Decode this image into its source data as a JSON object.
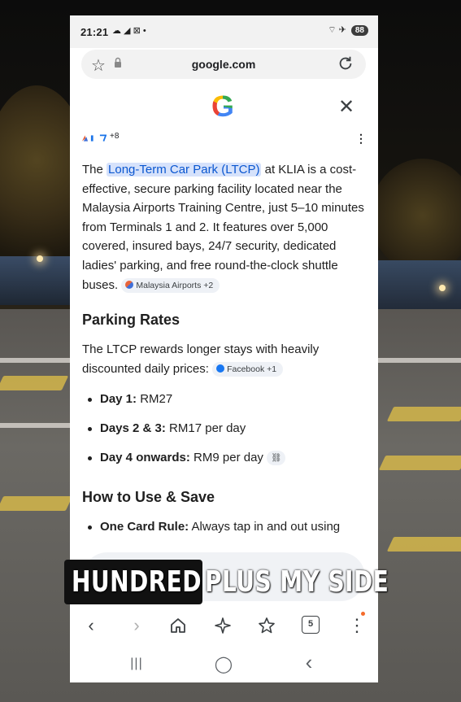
{
  "status_bar": {
    "time": "21:21",
    "left_icons": "☁ ◢ ⊠ •",
    "right_icons": "⌔ ✈",
    "battery": "88"
  },
  "url_bar": {
    "domain": "google.com"
  },
  "sources": {
    "extra_count": "+8"
  },
  "answer": {
    "intro_before": "The ",
    "intro_highlight": "Long-Term Car Park (LTCP)",
    "intro_after": " at KLIA is a cost-effective, secure parking facility located near the Malaysia Airports Training Centre, just 5–10 minutes from Terminals 1 and 2. It features over 5,000 covered, insured bays, 24/7 security, dedicated ladies' parking, and free round-the-clock shuttle buses.",
    "intro_chip": "Malaysia Airports +2",
    "rates_heading": "Parking Rates",
    "rates_text": "The LTCP rewards longer stays with heavily discounted daily prices:",
    "rates_chip": "Facebook +1",
    "rates": [
      {
        "label": "Day 1:",
        "value": " RM27"
      },
      {
        "label": "Days 2 & 3:",
        "value": " RM17 per day"
      },
      {
        "label": "Day 4 onwards:",
        "value": " RM9 per day"
      }
    ],
    "save_heading": "How to Use & Save",
    "save_items": [
      {
        "label": "One Card Rule:",
        "value": " Always tap in and out using"
      }
    ]
  },
  "caption": {
    "part1": "HUNDRED",
    "part2": "PLUS MY SIDE"
  },
  "bottom_nav": {
    "back": "‹",
    "forward": "›",
    "tabs_count": "5",
    "menu": "⋮"
  },
  "system_nav": {
    "recents": "|||",
    "home": "◯",
    "back": "‹"
  },
  "colors": {
    "highlight_bg": "#d6e2fb",
    "highlight_text": "#0b57d0",
    "chip_bg": "#eef1f6"
  }
}
